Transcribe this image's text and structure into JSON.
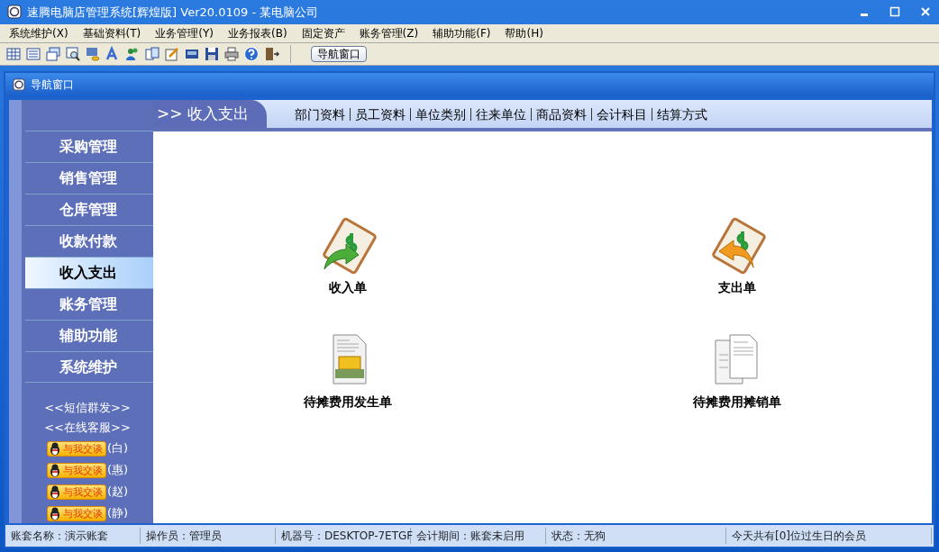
{
  "window": {
    "title": "速腾电脑店管理系统[辉煌版] Ver20.0109  -  某电脑公司"
  },
  "menu": [
    "系统维护(X)",
    "基础资料(T)",
    "业务管理(Y)",
    "业务报表(B)",
    "固定资产",
    "账务管理(Z)",
    "辅助功能(F)",
    "帮助(H)"
  ],
  "toolbar": {
    "button": "导航窗口"
  },
  "child_window": {
    "title": "导航窗口"
  },
  "sidebar": {
    "items": [
      {
        "label": "采购管理",
        "selected": false
      },
      {
        "label": "销售管理",
        "selected": false
      },
      {
        "label": "仓库管理",
        "selected": false
      },
      {
        "label": "收款付款",
        "selected": false
      },
      {
        "label": "收入支出",
        "selected": true
      },
      {
        "label": "账务管理",
        "selected": false
      },
      {
        "label": "辅助功能",
        "selected": false
      },
      {
        "label": "系统维护",
        "selected": false
      }
    ],
    "links": [
      "<<短信群发>>",
      "<<在线客服>>"
    ],
    "chat_contacts": [
      {
        "button": "与我交谈",
        "name": "(白)"
      },
      {
        "button": "与我交谈",
        "name": "(惠)"
      },
      {
        "button": "与我交谈",
        "name": "(赵)"
      },
      {
        "button": "与我交谈",
        "name": "(静)"
      }
    ]
  },
  "section": {
    "title": ">> 收入支出",
    "links": [
      "部门资料",
      "员工资料",
      "单位类别",
      "往来单位",
      "商品资料",
      "会计科目",
      "结算方式"
    ],
    "tiles": [
      {
        "kind": "income",
        "label": "收入单"
      },
      {
        "kind": "expense",
        "label": "支出单"
      },
      {
        "kind": "contract",
        "label": "待摊费用发生单"
      },
      {
        "kind": "documents",
        "label": "待摊费用摊销单"
      }
    ]
  },
  "status_bar": [
    "账套名称：演示账套",
    "操作员：管理员",
    "机器号：DESKTOP-7ETGF",
    "会计期间：账套未启用",
    "状态：无狗",
    "今天共有[0]位过生日的会员"
  ]
}
